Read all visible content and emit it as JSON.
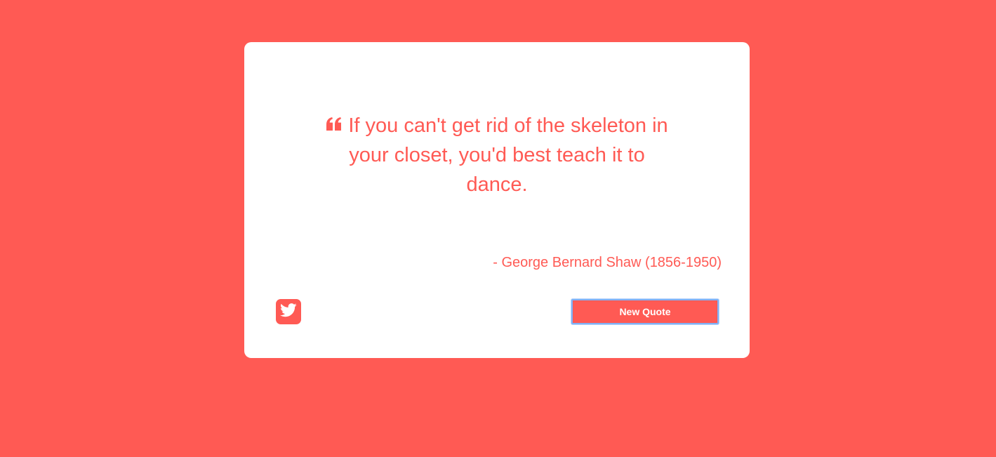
{
  "quote": {
    "text": "If you can't get rid of the skeleton in your closet, you'd best teach it to dance.",
    "icon": "quote-left-icon",
    "author": "- George Bernard Shaw (1856-1950)"
  },
  "actions": {
    "tweet_icon": "twitter-icon",
    "new_quote_label": "New Quote"
  },
  "colors": {
    "background": "#FF5A54",
    "card": "#FFFFFF",
    "accent": "#FF5A54",
    "focus_ring": "#7FB1F5"
  }
}
